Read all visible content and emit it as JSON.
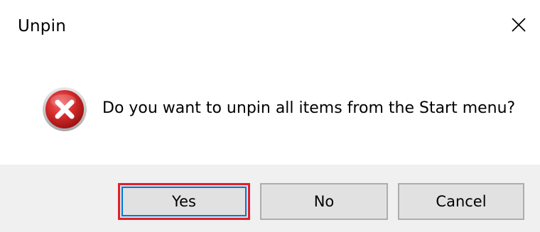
{
  "window": {
    "title": "Unpin"
  },
  "message": {
    "text": "Do you want to unpin all items from the Start menu?",
    "icon": "error-icon"
  },
  "buttons": {
    "yes": "Yes",
    "no": "No",
    "cancel": "Cancel"
  },
  "colors": {
    "error_red": "#d32424",
    "focus_highlight": "#e0202c",
    "footer_bg": "#f0f0f0",
    "button_bg": "#e1e1e1"
  }
}
